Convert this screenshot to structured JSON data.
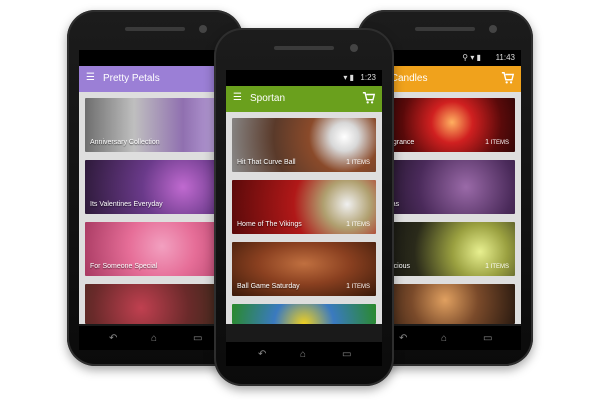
{
  "left_app": {
    "title": "Pretty Petals",
    "accent": "#9b7fd6",
    "items": [
      {
        "label": "Anniversary Collection"
      },
      {
        "label": "Its Valentines Everyday"
      },
      {
        "label": "For Someone Special"
      },
      {
        "label": ""
      }
    ]
  },
  "center_app": {
    "title": "Sportan",
    "accent": "#6aa01d",
    "time": "1:23",
    "items": [
      {
        "label": "Hit That Curve Ball",
        "count": "1",
        "count_unit": "ITEMS"
      },
      {
        "label": "Home of The Vikings",
        "count": "1",
        "count_unit": "ITEMS"
      },
      {
        "label": "Ball Game Saturday",
        "count": "1",
        "count_unit": "ITEMS"
      }
    ]
  },
  "right_app": {
    "title": "stic Candles",
    "accent": "#f0a21c",
    "time": "11:43",
    "items": [
      {
        "label": "al Fragrance",
        "count": "1",
        "count_unit": "ITEMS"
      },
      {
        "label": "Aromas",
        "count": "",
        "count_unit": ""
      },
      {
        "label": "& Delicious",
        "count": "1",
        "count_unit": "ITEMS"
      }
    ]
  },
  "icons": {
    "menu": "hamburger-icon",
    "cart": "shopping-cart-icon",
    "back": "back-icon",
    "home": "home-icon",
    "recents": "recents-icon"
  }
}
